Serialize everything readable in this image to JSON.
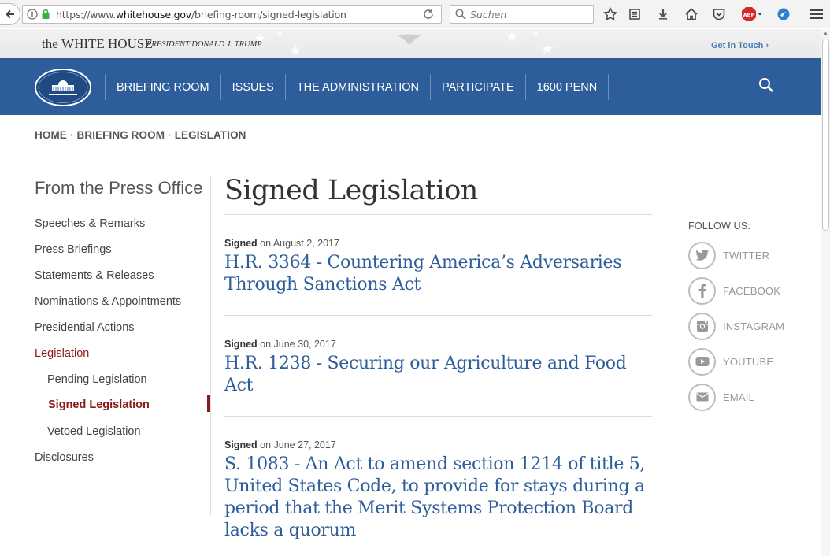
{
  "browser": {
    "url_prefix": "https://www.",
    "url_domain": "whitehouse.gov",
    "url_path": "/briefing-room/signed-legislation",
    "search_placeholder": "Suchen",
    "abp_badge": "ABP"
  },
  "site": {
    "brand_the": "the",
    "brand_name": "WHITE HOUSE",
    "brand_sub": "PRESIDENT DONALD J. TRUMP",
    "get_in_touch": "Get in Touch ›"
  },
  "nav": {
    "items": [
      {
        "label": "BRIEFING ROOM"
      },
      {
        "label": "ISSUES"
      },
      {
        "label": "THE ADMINISTRATION"
      },
      {
        "label": "PARTICIPATE"
      },
      {
        "label": "1600 PENN"
      }
    ]
  },
  "breadcrumb": {
    "items": [
      "HOME",
      "BRIEFING ROOM",
      "LEGISLATION"
    ],
    "sep": "·"
  },
  "sidebar": {
    "heading": "From the Press Office",
    "items": [
      {
        "label": "Speeches & Remarks"
      },
      {
        "label": "Press Briefings"
      },
      {
        "label": "Statements & Releases"
      },
      {
        "label": "Nominations & Appointments"
      },
      {
        "label": "Presidential Actions"
      },
      {
        "label": "Legislation"
      },
      {
        "label": "Pending Legislation"
      },
      {
        "label": "Signed Legislation"
      },
      {
        "label": "Vetoed Legislation"
      },
      {
        "label": "Disclosures"
      }
    ]
  },
  "main": {
    "title": "Signed Legislation",
    "entries": [
      {
        "signed": "Signed",
        "date": "on August 2, 2017",
        "title": "H.R. 3364 - Countering America’s Adversaries Through Sanctions Act"
      },
      {
        "signed": "Signed",
        "date": "on June 30, 2017",
        "title": "H.R. 1238 - Securing our Agriculture and Food Act"
      },
      {
        "signed": "Signed",
        "date": "on June 27, 2017",
        "title": "S. 1083 - An Act to amend section 1214 of title 5, United States Code, to provide for stays during a period that the Merit Systems Protection Board lacks a quorum"
      }
    ]
  },
  "follow": {
    "label": "FOLLOW US:",
    "items": [
      {
        "label": "TWITTER",
        "icon": "twitter-icon"
      },
      {
        "label": "FACEBOOK",
        "icon": "facebook-icon"
      },
      {
        "label": "INSTAGRAM",
        "icon": "instagram-icon"
      },
      {
        "label": "YOUTUBE",
        "icon": "youtube-icon"
      },
      {
        "label": "EMAIL",
        "icon": "email-icon"
      }
    ]
  },
  "colors": {
    "nav_blue": "#2e5d9b",
    "link_blue": "#2e5d9b",
    "active_red": "#8b1a1a"
  }
}
